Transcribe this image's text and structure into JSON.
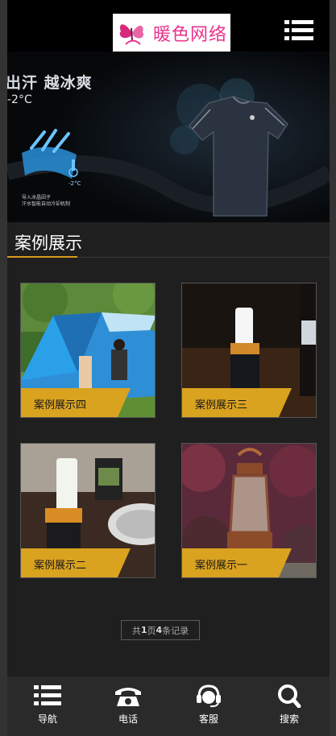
{
  "header": {
    "logo_text": "暖色网络",
    "menu_icon": "list-menu-icon"
  },
  "banner": {
    "slogan": "出汗 越冰爽",
    "temperature": "-2°C",
    "small_temperature": "-2°C",
    "caption_line1": "导入冰晶因子",
    "caption_line2": "汗水智能自动冷却机制"
  },
  "section": {
    "title": "案例展示"
  },
  "cases": [
    {
      "label": "案例展示四"
    },
    {
      "label": "案例展示三"
    },
    {
      "label": "案例展示二"
    },
    {
      "label": "案例展示一"
    }
  ],
  "pager": {
    "prefix": "共 ",
    "pages": "1",
    "middle": "页",
    "records": "4",
    "suffix": "条记录"
  },
  "bottom_nav": [
    {
      "label": "导航",
      "icon": "list-icon"
    },
    {
      "label": "电话",
      "icon": "phone-icon"
    },
    {
      "label": "客服",
      "icon": "headset-icon"
    },
    {
      "label": "搜索",
      "icon": "search-icon"
    }
  ],
  "colors": {
    "accent": "#d99a1e",
    "label_band": "#d9a21f",
    "background": "#1f1f1f"
  }
}
